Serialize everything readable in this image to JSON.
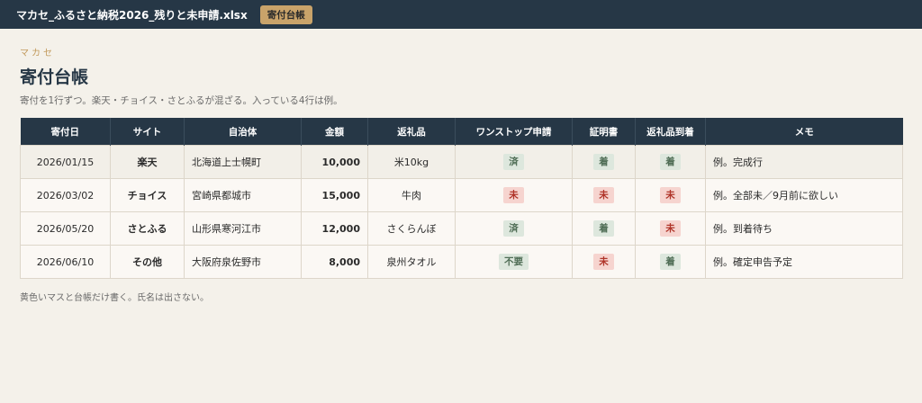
{
  "titlebar": {
    "file_name": "マカセ_ふるさと納税2026_残りと未申請.xlsx",
    "sheet_tab": "寄付台帳"
  },
  "brand": "マカセ",
  "page_title": "寄付台帳",
  "description": "寄付を1行ずつ。楽天・チョイス・さとふるが混ざる。入っている4行は例。",
  "table": {
    "headers": [
      "寄付日",
      "サイト",
      "自治体",
      "金額",
      "返礼品",
      "ワンストップ申請",
      "証明書",
      "返礼品到着",
      "メモ"
    ],
    "rows": [
      {
        "date": "2026/01/15",
        "site": "楽天",
        "municipality": "北海道上士幌町",
        "amount": "10,000",
        "gift": "米10kg",
        "onestop": {
          "label": "済",
          "status": "green"
        },
        "certificate": {
          "label": "着",
          "status": "green"
        },
        "arrival": {
          "label": "着",
          "status": "green"
        },
        "memo": "例。完成行"
      },
      {
        "date": "2026/03/02",
        "site": "チョイス",
        "municipality": "宮崎県都城市",
        "amount": "15,000",
        "gift": "牛肉",
        "onestop": {
          "label": "未",
          "status": "red"
        },
        "certificate": {
          "label": "未",
          "status": "red"
        },
        "arrival": {
          "label": "未",
          "status": "red"
        },
        "memo": "例。全部未／9月前に欲しい"
      },
      {
        "date": "2026/05/20",
        "site": "さとふる",
        "municipality": "山形県寒河江市",
        "amount": "12,000",
        "gift": "さくらんぼ",
        "onestop": {
          "label": "済",
          "status": "green"
        },
        "certificate": {
          "label": "着",
          "status": "green"
        },
        "arrival": {
          "label": "未",
          "status": "red"
        },
        "memo": "例。到着待ち"
      },
      {
        "date": "2026/06/10",
        "site": "その他",
        "municipality": "大阪府泉佐野市",
        "amount": "8,000",
        "gift": "泉州タオル",
        "onestop": {
          "label": "不要",
          "status": "green"
        },
        "certificate": {
          "label": "未",
          "status": "red"
        },
        "arrival": {
          "label": "着",
          "status": "green"
        },
        "memo": "例。確定申告予定"
      }
    ]
  },
  "footnote": "黄色いマスと台帳だけ書く。氏名は出さない。",
  "colors": {
    "header_bg": "#263746",
    "accent": "#c9a36a",
    "status_done_bg": "#dde7dd",
    "status_done_text": "#4f6d55",
    "status_pending_bg": "#f6d4cf",
    "status_pending_text": "#b0352a"
  }
}
